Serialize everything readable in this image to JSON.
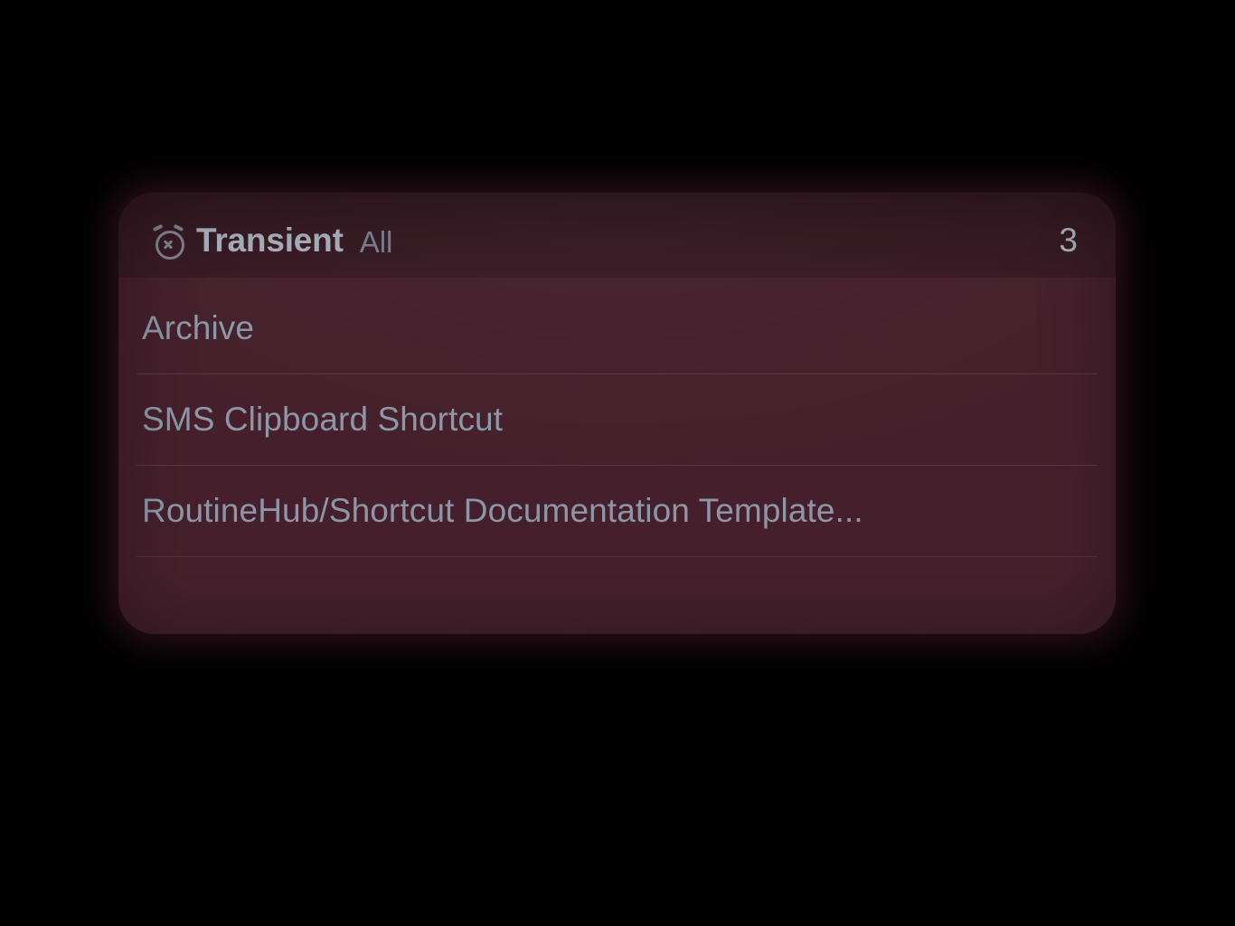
{
  "header": {
    "icon": "alarm-cancel-icon",
    "title": "Transient",
    "filter": "All",
    "count": "3"
  },
  "items": [
    {
      "label": "Archive"
    },
    {
      "label": "SMS Clipboard Shortcut"
    },
    {
      "label": "RoutineHub/Shortcut Documentation Template..."
    }
  ],
  "colors": {
    "widget_bg": "#4d2431",
    "text_primary": "#b8c0cc",
    "text_secondary": "#9ca8ba",
    "divider": "rgba(200,205,215,0.16)"
  }
}
